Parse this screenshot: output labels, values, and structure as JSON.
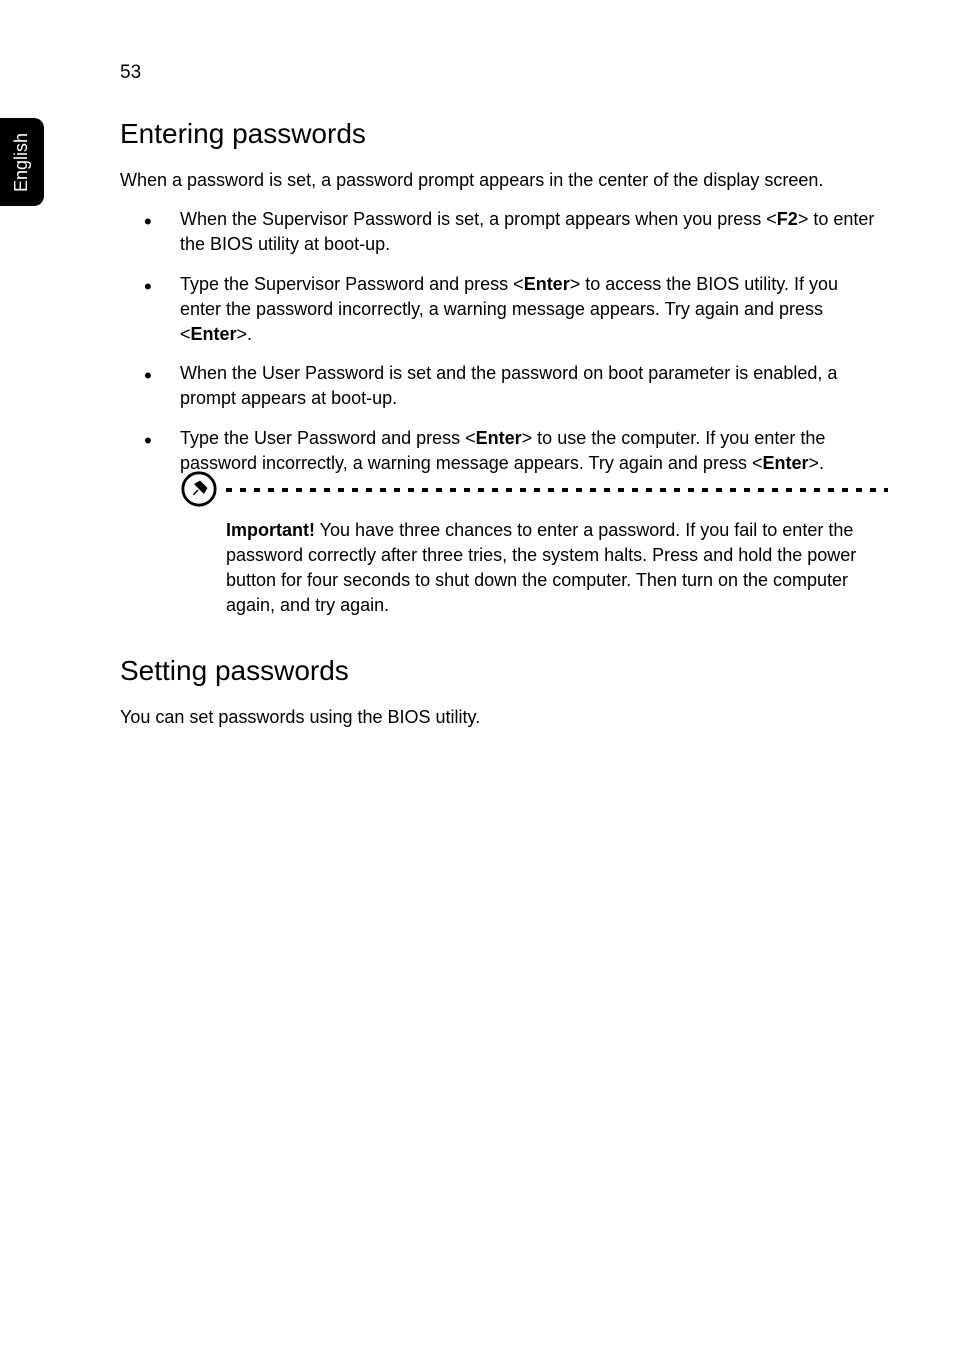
{
  "page": {
    "number": "53",
    "side_tab": "English"
  },
  "section1": {
    "heading": "Entering passwords",
    "intro": "When a password is set, a password prompt appears in the center of the display screen.",
    "bullets": {
      "b0_pre": "When the Supervisor Password is set, a prompt appears when you press <",
      "b0_key": "F2",
      "b0_post": "> to enter the BIOS utility at boot-up.",
      "b1_pre": "Type the Supervisor Password and press <",
      "b1_key1": "Enter",
      "b1_mid": "> to access the BIOS utility. If you enter the password incorrectly, a warning message appears. Try again and press <",
      "b1_key2": "Enter",
      "b1_post": ">.",
      "b2": "When the User Password is set and the password on boot parameter is enabled, a prompt appears at boot-up.",
      "b3_pre": "Type the User Password and press <",
      "b3_key1": "Enter",
      "b3_mid": "> to use the computer. If you enter the password incorrectly, a warning message appears. Try again and press <",
      "b3_key2": "Enter",
      "b3_post": ">."
    },
    "note": {
      "label": "Important!",
      "text": " You have three chances to enter a password. If you fail to enter the password correctly after three tries, the system halts. Press and hold the power button for four seconds to shut down the computer. Then turn on the computer again, and try again."
    }
  },
  "section2": {
    "heading": "Setting passwords",
    "text": "You can set passwords using the BIOS utility."
  }
}
